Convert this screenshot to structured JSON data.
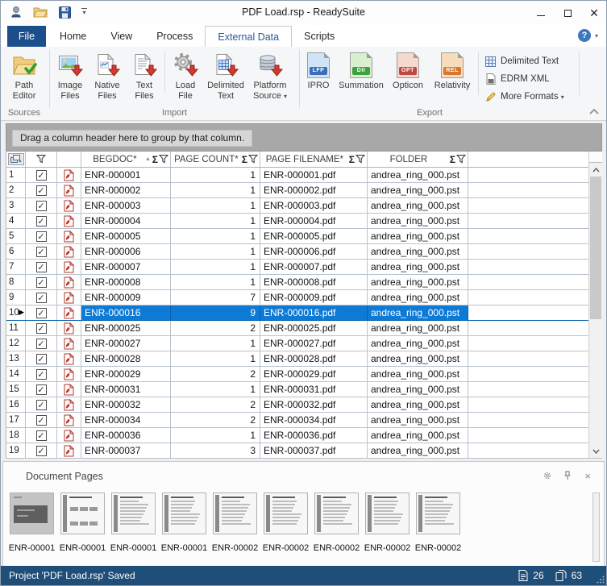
{
  "window": {
    "title": "PDF Load.rsp - ReadySuite",
    "quick_access_icons": [
      "app-logo-icon",
      "open-folder-icon",
      "save-icon",
      "customize-quick-access-caret-icon"
    ],
    "controls": [
      "minimize",
      "maximize",
      "close"
    ]
  },
  "tabs": {
    "file": "File",
    "items": [
      {
        "label": "Home",
        "active": false
      },
      {
        "label": "View",
        "active": false
      },
      {
        "label": "Process",
        "active": false
      },
      {
        "label": "External Data",
        "active": true
      },
      {
        "label": "Scripts",
        "active": false
      }
    ]
  },
  "ribbon": {
    "sources": {
      "label": "Sources",
      "buttons": [
        {
          "label": "Path Editor",
          "icon": "folder-check-icon"
        }
      ]
    },
    "import": {
      "label": "Import",
      "buttons": [
        {
          "label": "Image Files",
          "icon": "image-file-download-icon"
        },
        {
          "label": "Native Files",
          "icon": "native-file-download-icon"
        },
        {
          "label": "Text Files",
          "icon": "text-file-download-icon"
        },
        {
          "label": "Load File",
          "icon": "gear-download-icon"
        },
        {
          "label": "Delimited Text",
          "icon": "delimited-file-download-icon"
        },
        {
          "label": "Platform Source",
          "icon": "database-download-icon",
          "dropdown": true
        }
      ]
    },
    "export": {
      "label": "Export",
      "buttons": [
        {
          "label": "IPRO",
          "badge": "LFP",
          "badge_color": "#3e6db5",
          "tint": "#cfe4f7"
        },
        {
          "label": "Summation",
          "badge": "DII",
          "badge_color": "#3da23d",
          "tint": "#d9efcf"
        },
        {
          "label": "Opticon",
          "badge": "OPT",
          "badge_color": "#bf4a41",
          "tint": "#f6d9cd"
        },
        {
          "label": "Relativity",
          "badge": "REL",
          "badge_color": "#d8772e",
          "tint": "#f7dcbd"
        }
      ],
      "side_buttons": [
        {
          "label": "Delimited Text",
          "icon": "table-icon",
          "dropdown": false
        },
        {
          "label": "EDRM XML",
          "icon": "xml-file-icon",
          "dropdown": false
        },
        {
          "label": "More Formats",
          "icon": "pencil-icon",
          "dropdown": true
        }
      ]
    }
  },
  "grid": {
    "group_by_hint": "Drag a column header here to group by that column.",
    "columns": [
      {
        "label": "BEGDOC*",
        "sorted": "asc"
      },
      {
        "label": "PAGE COUNT*",
        "sorted": ""
      },
      {
        "label": "PAGE FILENAME*",
        "sorted": ""
      },
      {
        "label": "FOLDER",
        "sorted": ""
      }
    ],
    "rows": [
      {
        "n": "1",
        "begdoc": "ENR-000001",
        "page_count": "1",
        "filename": "ENR-000001.pdf",
        "folder": "andrea_ring_000.pst",
        "checked": true,
        "selected": false
      },
      {
        "n": "2",
        "begdoc": "ENR-000002",
        "page_count": "1",
        "filename": "ENR-000002.pdf",
        "folder": "andrea_ring_000.pst",
        "checked": true,
        "selected": false
      },
      {
        "n": "3",
        "begdoc": "ENR-000003",
        "page_count": "1",
        "filename": "ENR-000003.pdf",
        "folder": "andrea_ring_000.pst",
        "checked": true,
        "selected": false
      },
      {
        "n": "4",
        "begdoc": "ENR-000004",
        "page_count": "1",
        "filename": "ENR-000004.pdf",
        "folder": "andrea_ring_000.pst",
        "checked": true,
        "selected": false
      },
      {
        "n": "5",
        "begdoc": "ENR-000005",
        "page_count": "1",
        "filename": "ENR-000005.pdf",
        "folder": "andrea_ring_000.pst",
        "checked": true,
        "selected": false
      },
      {
        "n": "6",
        "begdoc": "ENR-000006",
        "page_count": "1",
        "filename": "ENR-000006.pdf",
        "folder": "andrea_ring_000.pst",
        "checked": true,
        "selected": false
      },
      {
        "n": "7",
        "begdoc": "ENR-000007",
        "page_count": "1",
        "filename": "ENR-000007.pdf",
        "folder": "andrea_ring_000.pst",
        "checked": true,
        "selected": false
      },
      {
        "n": "8",
        "begdoc": "ENR-000008",
        "page_count": "1",
        "filename": "ENR-000008.pdf",
        "folder": "andrea_ring_000.pst",
        "checked": true,
        "selected": false
      },
      {
        "n": "9",
        "begdoc": "ENR-000009",
        "page_count": "7",
        "filename": "ENR-000009.pdf",
        "folder": "andrea_ring_000.pst",
        "checked": true,
        "selected": false
      },
      {
        "n": "10",
        "begdoc": "ENR-000016",
        "page_count": "9",
        "filename": "ENR-000016.pdf",
        "folder": "andrea_ring_000.pst",
        "checked": true,
        "selected": true
      },
      {
        "n": "11",
        "begdoc": "ENR-000025",
        "page_count": "2",
        "filename": "ENR-000025.pdf",
        "folder": "andrea_ring_000.pst",
        "checked": true,
        "selected": false
      },
      {
        "n": "12",
        "begdoc": "ENR-000027",
        "page_count": "1",
        "filename": "ENR-000027.pdf",
        "folder": "andrea_ring_000.pst",
        "checked": true,
        "selected": false
      },
      {
        "n": "13",
        "begdoc": "ENR-000028",
        "page_count": "1",
        "filename": "ENR-000028.pdf",
        "folder": "andrea_ring_000.pst",
        "checked": true,
        "selected": false
      },
      {
        "n": "14",
        "begdoc": "ENR-000029",
        "page_count": "2",
        "filename": "ENR-000029.pdf",
        "folder": "andrea_ring_000.pst",
        "checked": true,
        "selected": false
      },
      {
        "n": "15",
        "begdoc": "ENR-000031",
        "page_count": "1",
        "filename": "ENR-000031.pdf",
        "folder": "andrea_ring_000.pst",
        "checked": true,
        "selected": false
      },
      {
        "n": "16",
        "begdoc": "ENR-000032",
        "page_count": "2",
        "filename": "ENR-000032.pdf",
        "folder": "andrea_ring_000.pst",
        "checked": true,
        "selected": false
      },
      {
        "n": "17",
        "begdoc": "ENR-000034",
        "page_count": "2",
        "filename": "ENR-000034.pdf",
        "folder": "andrea_ring_000.pst",
        "checked": true,
        "selected": false
      },
      {
        "n": "18",
        "begdoc": "ENR-000036",
        "page_count": "1",
        "filename": "ENR-000036.pdf",
        "folder": "andrea_ring_000.pst",
        "checked": true,
        "selected": false
      },
      {
        "n": "19",
        "begdoc": "ENR-000037",
        "page_count": "3",
        "filename": "ENR-000037.pdf",
        "folder": "andrea_ring_000.pst",
        "checked": true,
        "selected": false
      }
    ]
  },
  "document_pages": {
    "title": "Document Pages",
    "header_icons": [
      "gear-icon",
      "pin-icon",
      "close-icon"
    ],
    "thumbnails": [
      {
        "label": "ENR-00001",
        "style": "dark"
      },
      {
        "label": "ENR-00001",
        "style": "diagram"
      },
      {
        "label": "ENR-00001",
        "style": "text"
      },
      {
        "label": "ENR-00001",
        "style": "text"
      },
      {
        "label": "ENR-00002",
        "style": "text"
      },
      {
        "label": "ENR-00002",
        "style": "text"
      },
      {
        "label": "ENR-00002",
        "style": "text"
      },
      {
        "label": "ENR-00002",
        "style": "text"
      },
      {
        "label": "ENR-00002",
        "style": "text"
      }
    ]
  },
  "status_bar": {
    "text": "Project 'PDF Load.rsp' Saved",
    "documents_count": "26",
    "pages_count": "63",
    "background": "#1f4e79"
  }
}
